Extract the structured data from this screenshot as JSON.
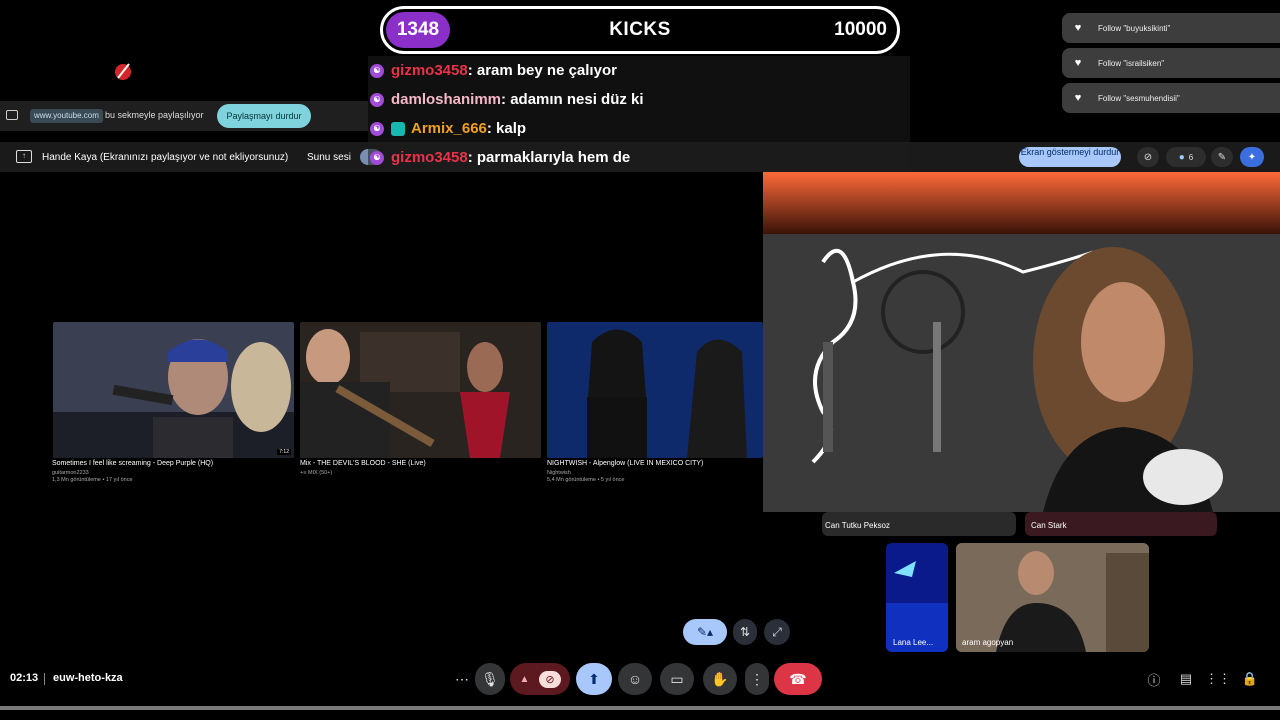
{
  "overlay": {
    "kicks": {
      "count": "1348",
      "label": "KICKS",
      "goal": "10000"
    },
    "follows": [
      {
        "label": "Follow \"buyuksikinti\""
      },
      {
        "label": "Follow \"israilsiken\""
      },
      {
        "label": "Follow \"sesmuhendisii\""
      }
    ],
    "chat": [
      {
        "user": "gizmo3458",
        "user_color": "#e8324a",
        "message": " : aram bey ne çalıyor"
      },
      {
        "user": "damloshanimm",
        "user_color": "#f5b8c8",
        "message": " : adamın nesi düz ki"
      },
      {
        "user": "Armix_666",
        "user_color": "#f0a020",
        "message": " : kalp"
      },
      {
        "user": "gizmo3458",
        "user_color": "#e8324a",
        "message": " : parmaklarıyla hem de"
      }
    ]
  },
  "sharebar": {
    "url": "www.youtube.com",
    "text": "bu sekmeyle paylaşılıyor",
    "stop_label": "Paylaşmayı durdur"
  },
  "presentbar": {
    "text": "Hande Kaya (Ekranınızı paylaşıyor ve not ekliyorsunuz)",
    "audio_label": "Sunu sesi",
    "stop_label": "Ekran göstermeyi durdur",
    "participant_count": "6"
  },
  "videos": [
    {
      "title": "Sometimes I feel like screaming - Deep Purple (HQ)",
      "channel": "guitarmon2233",
      "meta": "1,3 Mn görüntüleme • 17 yıl önce",
      "duration": "7:12"
    },
    {
      "title": "Mix - THE DEVIL'S BLOOD - SHE (Live)",
      "channel": "+≡ MIX (50+)",
      "meta": "",
      "duration": ""
    },
    {
      "title": "NIGHTWISH - Alpenglow (LIVE IN MEXICO CITY)",
      "channel": "Nightwish",
      "meta": "5,4 Mn görüntüleme • 5 yıl önce",
      "duration": ""
    }
  ],
  "participants": [
    {
      "name": "Can Tutku Peksoz"
    },
    {
      "name": "Can Stark"
    },
    {
      "name": "Lana Lee..."
    },
    {
      "name": "aram agopyan"
    }
  ],
  "meeting": {
    "time": "02:13",
    "code": "euw-heto-kza"
  },
  "colors": {
    "accent_blue": "#a8c7fa",
    "end_call": "#dc3545",
    "share_teal": "#7fd3dc",
    "kicks_purple": "#8b2fc9"
  }
}
